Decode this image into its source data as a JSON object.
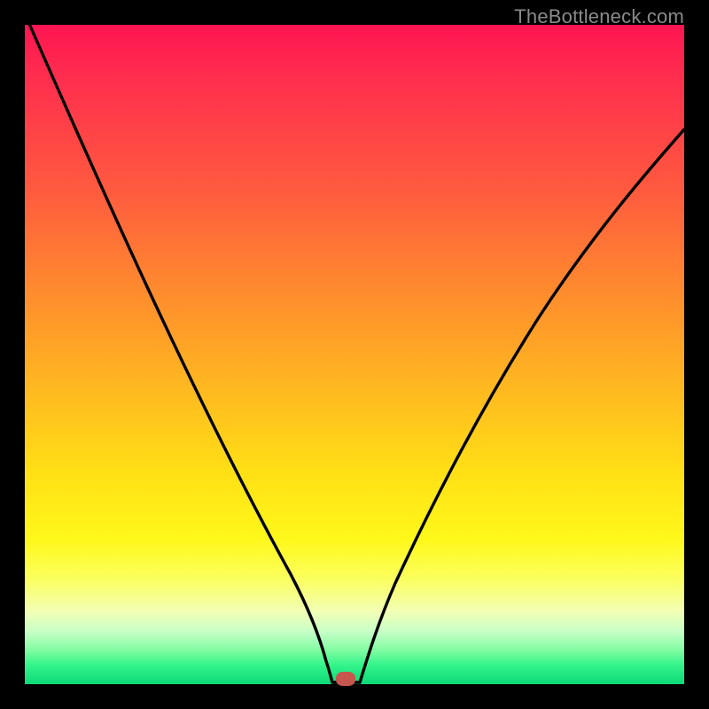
{
  "watermark": "TheBottleneck.com",
  "chart_data": {
    "type": "line",
    "title": "",
    "xlabel": "",
    "ylabel": "",
    "xlim": [
      0,
      100
    ],
    "ylim": [
      0,
      100
    ],
    "grid": false,
    "legend": false,
    "series": [
      {
        "name": "bottleneck-curve",
        "x": [
          0,
          6,
          12,
          18,
          24,
          30,
          35,
          40,
          43,
          44.5,
          46,
          47,
          48,
          51,
          55,
          60,
          66,
          73,
          81,
          90,
          100
        ],
        "values": [
          100,
          88,
          76,
          64,
          52,
          40,
          30,
          20,
          12,
          6,
          2,
          1,
          0,
          0,
          10,
          22,
          35,
          48,
          61,
          74,
          86
        ],
        "note": "V-shaped bottleneck curve; near-linear steep left arm, convex right arm; minimum at x≈48–51."
      }
    ],
    "marker": {
      "x": 48,
      "y": 0,
      "name": "optimal-point"
    },
    "colors": {
      "curve": "#000000",
      "marker": "#c7564e",
      "gradient_top": "#ff1452",
      "gradient_mid": "#fff81a",
      "gradient_bottom": "#0cd977",
      "frame": "#000000"
    }
  }
}
